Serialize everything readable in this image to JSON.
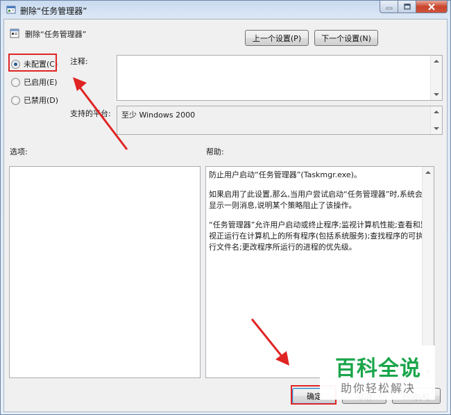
{
  "window": {
    "title": "删除“任务管理器”",
    "controls": {
      "minimize": "minimize-icon",
      "maximize": "maximize-icon",
      "close": "close-icon"
    }
  },
  "header": {
    "policy_name": "删除“任务管理器”",
    "prev_button": "上一个设置(P)",
    "next_button": "下一个设置(N)"
  },
  "state": {
    "options": [
      {
        "label": "未配置(C)",
        "selected": true
      },
      {
        "label": "已启用(E)",
        "selected": false
      },
      {
        "label": "已禁用(D)",
        "selected": false
      }
    ]
  },
  "comment": {
    "label": "注释:",
    "value": ""
  },
  "supported": {
    "label": "支持的平台:",
    "value": "至少 Windows 2000"
  },
  "options_panel": {
    "label": "选项:"
  },
  "help": {
    "label": "帮助:",
    "paragraphs": [
      "防止用户启动“任务管理器”(Taskmgr.exe)。",
      "如果启用了此设置,那么,当用户尝试启动“任务管理器”时,系统会显示一则消息,说明某个策略阻止了该操作。",
      "“任务管理器”允许用户启动或终止程序;监视计算机性能;查看和监视正运行在计算机上的所有程序(包括系统服务);查找程序的可执行文件名;更改程序所运行的进程的优先级。"
    ]
  },
  "footer": {
    "ok": "确定",
    "cancel": "取消",
    "apply": "应用(A)"
  },
  "watermark": {
    "main": "百科全说",
    "sub": "助你轻松解决"
  },
  "colors": {
    "annotation": "#e02424",
    "watermark_green": "#1aa54a"
  }
}
